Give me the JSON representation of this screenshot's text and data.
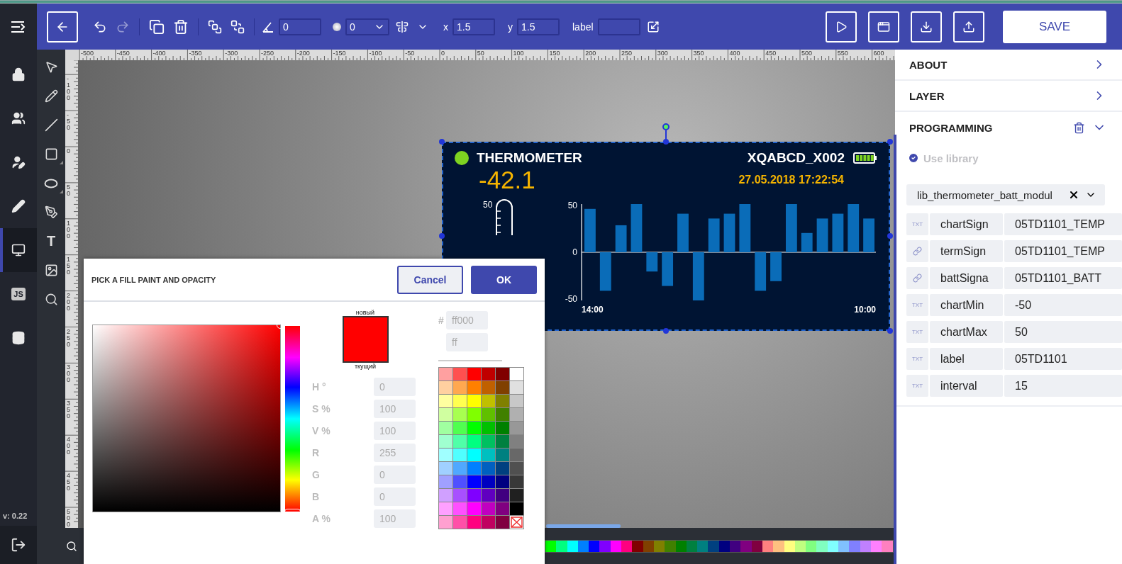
{
  "toolbar": {
    "history": [
      {
        "kind": "undo",
        "disabled": false
      },
      {
        "kind": "redo",
        "disabled": true
      }
    ],
    "angle_value": "0",
    "opacity_value": "0",
    "x": {
      "label": "x",
      "value": "1.5"
    },
    "y": {
      "label": "y",
      "value": "1.5"
    },
    "label_field": {
      "label": "label"
    },
    "actions": [
      {
        "kind": "play"
      },
      {
        "kind": "preview"
      },
      {
        "kind": "download"
      },
      {
        "kind": "upload"
      }
    ],
    "save_label": "SAVE"
  },
  "sidebar": {
    "items": [
      {
        "kind": "lock",
        "selected": false
      },
      {
        "kind": "users",
        "selected": false
      },
      {
        "kind": "user_edit",
        "selected": false
      },
      {
        "kind": "pencil",
        "selected": false
      },
      {
        "kind": "screen",
        "selected": true
      },
      {
        "kind": "script",
        "label": "JS",
        "selected": false
      },
      {
        "kind": "database",
        "selected": false
      }
    ],
    "version": "v: 0.22"
  },
  "tools": [
    {
      "kind": "select",
      "submenu": false
    },
    {
      "kind": "pencil",
      "submenu": false
    },
    {
      "kind": "line",
      "submenu": false
    },
    {
      "kind": "rect",
      "submenu": true
    },
    {
      "kind": "ellipse",
      "submenu": true
    },
    {
      "kind": "pen",
      "submenu": false
    },
    {
      "kind": "text",
      "label": "T",
      "submenu": false
    },
    {
      "kind": "image",
      "submenu": false
    },
    {
      "kind": "zoom",
      "submenu": false
    }
  ],
  "rulers": {
    "horizontal": [
      "-500",
      "-450",
      "-400",
      "-350",
      "-300",
      "-250",
      "-200",
      "-150",
      "-100",
      "-50",
      "0",
      "50",
      "100",
      "150",
      "200",
      "250",
      "300",
      "350",
      "400",
      "450",
      "500",
      "550",
      "600"
    ],
    "vertical": [
      "-100",
      "-50",
      "0",
      "50",
      "100",
      "150",
      "200",
      "250",
      "300",
      "350",
      "400",
      "450",
      "500"
    ]
  },
  "widget": {
    "status_dot": {
      "color": "#7ed321"
    },
    "title": "THERMOMETER",
    "device": "XQABCD_X002",
    "value": "-42.1",
    "timestamp": "27.05.2018 17:22:54",
    "gauge_label": "50",
    "chart_data": {
      "type": "bar",
      "values": [
        45,
        -40,
        28,
        50,
        -20,
        -35,
        40,
        -50,
        35,
        40,
        50,
        -40,
        -30,
        50,
        20,
        35,
        40,
        50,
        35
      ],
      "yticks": [
        -50,
        0,
        50
      ],
      "ylim": [
        -50,
        50
      ]
    },
    "time_start": "14:00",
    "time_end": "10:00"
  },
  "palette": [
    {
      "color": "#00ff00"
    },
    {
      "color": "#00ff80"
    },
    {
      "color": "#00ffff"
    },
    {
      "color": "#0080ff"
    },
    {
      "color": "#0000ff"
    },
    {
      "color": "#8000ff"
    },
    {
      "color": "#ff00ff"
    },
    {
      "color": "#ff0080"
    },
    {
      "color": "#800000"
    },
    {
      "color": "#804000"
    },
    {
      "color": "#808000"
    },
    {
      "color": "#408000"
    },
    {
      "color": "#008000"
    },
    {
      "color": "#008040"
    },
    {
      "color": "#008080"
    },
    {
      "color": "#004080"
    },
    {
      "color": "#000080"
    },
    {
      "color": "#400080"
    },
    {
      "color": "#800080"
    },
    {
      "color": "#800040"
    },
    {
      "color": "#ff8080"
    },
    {
      "color": "#ffc080"
    },
    {
      "color": "#ffff80"
    },
    {
      "color": "#c0ff80"
    },
    {
      "color": "#80ff80"
    },
    {
      "color": "#80ffc0"
    },
    {
      "color": "#80ffff"
    },
    {
      "color": "#80c0ff"
    },
    {
      "color": "#8080ff"
    },
    {
      "color": "#c080ff"
    },
    {
      "color": "#ff80ff"
    },
    {
      "color": "#ff80c0"
    }
  ],
  "color_dialog": {
    "title": "PICK A FILL PAINT AND OPACITY",
    "cancel": "Cancel",
    "ok": "OK",
    "preview": {
      "new_label": "новый",
      "current_label": "ткущий",
      "color": "#ff0000"
    },
    "fields": [
      {
        "label": "H °",
        "value": "0"
      },
      {
        "label": "S %",
        "value": "100"
      },
      {
        "label": "V %",
        "value": "100"
      },
      {
        "label": "R",
        "value": "255"
      },
      {
        "label": "G",
        "value": "0"
      },
      {
        "label": "B",
        "value": "0"
      },
      {
        "label": "A %",
        "value": "100"
      }
    ],
    "hue": {
      "level": 0
    },
    "hex_label": "#",
    "hex_value": "ff000",
    "alpha_value": "ff",
    "swatches": [
      {
        "kind": "color",
        "color": "#ffa0a0"
      },
      {
        "kind": "color",
        "color": "#ff5050"
      },
      {
        "kind": "color",
        "color": "#ff0000"
      },
      {
        "kind": "color",
        "color": "#c00000"
      },
      {
        "kind": "color",
        "color": "#800000"
      },
      {
        "kind": "color",
        "color": "#ffffff"
      },
      {
        "kind": "color",
        "color": "#ffd0a0"
      },
      {
        "kind": "color",
        "color": "#ffa850"
      },
      {
        "kind": "color",
        "color": "#ff8000"
      },
      {
        "kind": "color",
        "color": "#c06000"
      },
      {
        "kind": "color",
        "color": "#804000"
      },
      {
        "kind": "color",
        "color": "#e0e0e0"
      },
      {
        "kind": "color",
        "color": "#ffffa0"
      },
      {
        "kind": "color",
        "color": "#ffff50"
      },
      {
        "kind": "color",
        "color": "#ffff00"
      },
      {
        "kind": "color",
        "color": "#c0c000"
      },
      {
        "kind": "color",
        "color": "#808000"
      },
      {
        "kind": "color",
        "color": "#c8c8c8"
      },
      {
        "kind": "color",
        "color": "#d0ffa0"
      },
      {
        "kind": "color",
        "color": "#a8ff50"
      },
      {
        "kind": "color",
        "color": "#80ff00"
      },
      {
        "kind": "color",
        "color": "#60c000"
      },
      {
        "kind": "color",
        "color": "#408000"
      },
      {
        "kind": "color",
        "color": "#b0b0b0"
      },
      {
        "kind": "color",
        "color": "#a0ffa0"
      },
      {
        "kind": "color",
        "color": "#50ff50"
      },
      {
        "kind": "color",
        "color": "#00ff00"
      },
      {
        "kind": "color",
        "color": "#00c000"
      },
      {
        "kind": "color",
        "color": "#008000"
      },
      {
        "kind": "color",
        "color": "#989898"
      },
      {
        "kind": "color",
        "color": "#a0ffd0"
      },
      {
        "kind": "color",
        "color": "#50ffa8"
      },
      {
        "kind": "color",
        "color": "#00ff80"
      },
      {
        "kind": "color",
        "color": "#00c060"
      },
      {
        "kind": "color",
        "color": "#008040"
      },
      {
        "kind": "color",
        "color": "#808080"
      },
      {
        "kind": "color",
        "color": "#a0ffff"
      },
      {
        "kind": "color",
        "color": "#50ffff"
      },
      {
        "kind": "color",
        "color": "#00ffff"
      },
      {
        "kind": "color",
        "color": "#00c0c0"
      },
      {
        "kind": "color",
        "color": "#008080"
      },
      {
        "kind": "color",
        "color": "#686868"
      },
      {
        "kind": "color",
        "color": "#a0d0ff"
      },
      {
        "kind": "color",
        "color": "#50a8ff"
      },
      {
        "kind": "color",
        "color": "#0080ff"
      },
      {
        "kind": "color",
        "color": "#0060c0"
      },
      {
        "kind": "color",
        "color": "#004080"
      },
      {
        "kind": "color",
        "color": "#505050"
      },
      {
        "kind": "color",
        "color": "#a0a0ff"
      },
      {
        "kind": "color",
        "color": "#5050ff"
      },
      {
        "kind": "color",
        "color": "#0000ff"
      },
      {
        "kind": "color",
        "color": "#0000c0"
      },
      {
        "kind": "color",
        "color": "#000080"
      },
      {
        "kind": "color",
        "color": "#383838"
      },
      {
        "kind": "color",
        "color": "#d0a0ff"
      },
      {
        "kind": "color",
        "color": "#a850ff"
      },
      {
        "kind": "color",
        "color": "#8000ff"
      },
      {
        "kind": "color",
        "color": "#6000c0"
      },
      {
        "kind": "color",
        "color": "#400080"
      },
      {
        "kind": "color",
        "color": "#202020"
      },
      {
        "kind": "color",
        "color": "#ffa0ff"
      },
      {
        "kind": "color",
        "color": "#ff50ff"
      },
      {
        "kind": "color",
        "color": "#ff00ff"
      },
      {
        "kind": "color",
        "color": "#c000c0"
      },
      {
        "kind": "color",
        "color": "#800080"
      },
      {
        "kind": "color",
        "color": "#000000"
      },
      {
        "kind": "color",
        "color": "#ffa0d0"
      },
      {
        "kind": "color",
        "color": "#ff50a8"
      },
      {
        "kind": "color",
        "color": "#ff0080"
      },
      {
        "kind": "color",
        "color": "#c00060"
      },
      {
        "kind": "color",
        "color": "#800040"
      },
      {
        "kind": "none"
      }
    ]
  },
  "panel": {
    "sections": [
      {
        "title": "ABOUT",
        "expanded": false
      },
      {
        "title": "LAYER",
        "expanded": false
      },
      {
        "title": "PROGRAMMING",
        "expanded": true
      }
    ],
    "use_library": {
      "label": "Use library",
      "checked": true
    },
    "library": "lib_thermometer_batt_modul",
    "params": [
      {
        "kind": "text",
        "type_label": "TXT",
        "name": "chartSign",
        "value": "05TD1101_TEMP"
      },
      {
        "kind": "link",
        "name": "termSign",
        "value": "05TD1101_TEMP"
      },
      {
        "kind": "link",
        "name": "battSigna",
        "value": "05TD1101_BATT"
      },
      {
        "kind": "text",
        "type_label": "TXT",
        "name": "chartMin",
        "value": "-50"
      },
      {
        "kind": "text",
        "type_label": "TXT",
        "name": "chartMax",
        "value": "50"
      },
      {
        "kind": "text",
        "type_label": "TXT",
        "name": "label",
        "value": "05TD1101"
      },
      {
        "kind": "text",
        "type_label": "TXT",
        "name": "interval",
        "value": "15"
      }
    ]
  }
}
